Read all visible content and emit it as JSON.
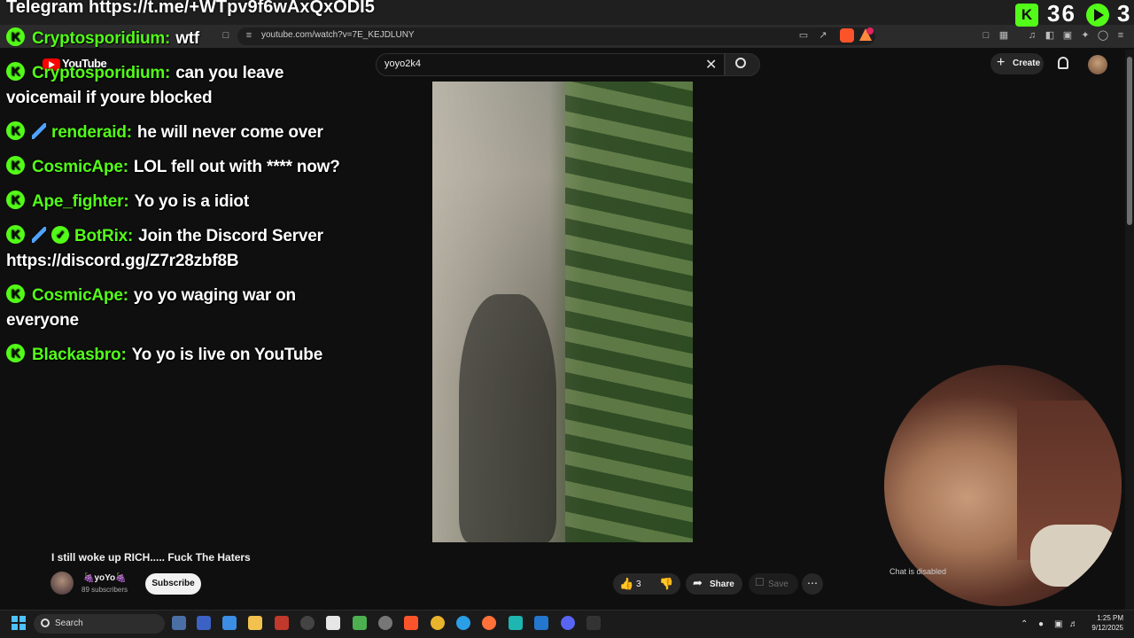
{
  "overlay": {
    "telegram_text": "Telegram https://t.me/+WTpv9f6wAxQxODI5",
    "kick_count": "36",
    "live_count": "3",
    "accent_color": "#53fc18"
  },
  "browser": {
    "url": "youtube.com/watch?v=7E_KEJDLUNY",
    "icons": [
      "bookmark-icon",
      "site-info-icon",
      "cast-icon",
      "share-icon",
      "brave-shields-icon",
      "rewards-icon",
      "extensions-icon",
      "sidebar-icon",
      "menu-icon"
    ]
  },
  "youtube": {
    "logo_text": "YouTube",
    "search_value": "yoyo2k4",
    "create_label": "Create"
  },
  "chat": [
    {
      "user": "Cryptosporidium:",
      "msg": "wtf",
      "badges": [
        "kick"
      ]
    },
    {
      "user": "Cryptosporidium:",
      "msg": "can you leave voicemail if youre blocked",
      "badges": [
        "kick"
      ]
    },
    {
      "user": "renderaid:",
      "msg": "he will never come over",
      "badges": [
        "kick",
        "sword"
      ]
    },
    {
      "user": "CosmicApe:",
      "msg": "LOL fell out with **** now?",
      "badges": [
        "kick"
      ]
    },
    {
      "user": "Ape_fighter:",
      "msg": "Yo yo is a idiot",
      "badges": [
        "kick"
      ]
    },
    {
      "user": "BotRix:",
      "msg": "Join the Discord Server https://discord.gg/Z7r28zbf8B",
      "badges": [
        "kick",
        "sword",
        "verified"
      ]
    },
    {
      "user": "CosmicApe:",
      "msg": "yo yo waging war on everyone",
      "badges": [
        "kick"
      ]
    },
    {
      "user": "Blackasbro:",
      "msg": "Yo yo is live on YouTube",
      "badges": [
        "kick"
      ]
    }
  ],
  "video": {
    "title": "I still woke up RICH..... Fuck The Haters",
    "channel": "yoYo",
    "subscribers": "89 subscribers",
    "subscribe_label": "Subscribe",
    "like_count": "3",
    "share_label": "Share",
    "save_label": "Save",
    "chat_status": "Chat is disabled"
  },
  "taskbar": {
    "search_label": "Search",
    "time": "1:25 PM",
    "date": "9/12/2025"
  }
}
